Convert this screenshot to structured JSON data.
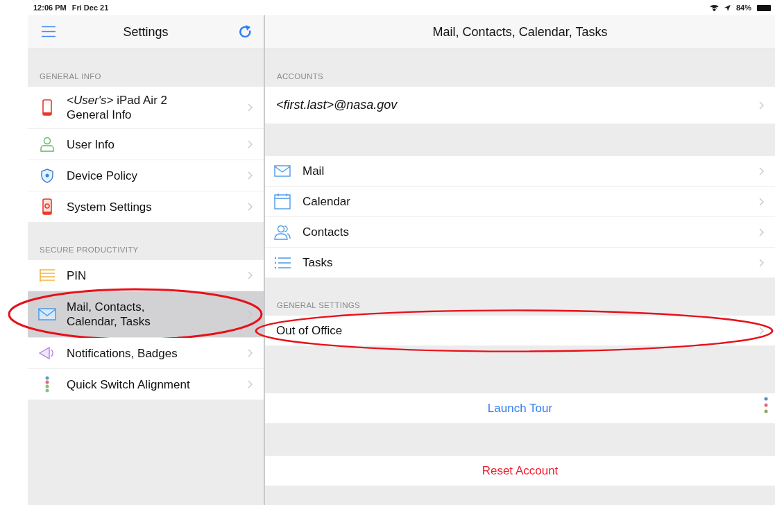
{
  "status_bar": {
    "time": "12:06 PM",
    "date": "Fri Dec 21",
    "battery": "84%"
  },
  "sidebar": {
    "title": "Settings",
    "sections": [
      {
        "header": "GENERAL INFO",
        "items": [
          {
            "kind": "phone",
            "label": "*<User's>* iPad Air 2",
            "sublabel": "General Info",
            "selected": false,
            "circled": false
          },
          {
            "kind": "person",
            "label": "User Info",
            "selected": false,
            "circled": false
          },
          {
            "kind": "shield",
            "label": "Device Policy",
            "selected": false,
            "circled": false
          },
          {
            "kind": "device",
            "label": "System Settings",
            "selected": false,
            "circled": false
          }
        ]
      },
      {
        "header": "SECURE PRODUCTIVITY",
        "items": [
          {
            "kind": "list",
            "label": "PIN",
            "selected": false,
            "circled": false
          },
          {
            "kind": "mail",
            "label": "Mail, Contacts,",
            "sublabel": "Calendar, Tasks",
            "selected": true,
            "circled": true
          },
          {
            "kind": "speaker",
            "label": "Notifications, Badges",
            "selected": false,
            "circled": false
          },
          {
            "kind": "dots",
            "label": "Quick Switch Alignment",
            "selected": false,
            "circled": false
          }
        ]
      }
    ]
  },
  "detail": {
    "title": "Mail, Contacts, Calendar, Tasks",
    "groups": [
      {
        "header": "ACCOUNTS",
        "rows": [
          {
            "kind": "account",
            "label": "<first.last>@nasa.gov",
            "circled": false
          }
        ]
      },
      {
        "rows": [
          {
            "kind": "mail",
            "label": "Mail",
            "circled": false
          },
          {
            "kind": "calendar",
            "label": "Calendar",
            "circled": false
          },
          {
            "kind": "contacts",
            "label": "Contacts",
            "circled": false
          },
          {
            "kind": "tasks",
            "label": "Tasks",
            "circled": false
          }
        ]
      },
      {
        "header": "GENERAL SETTINGS",
        "rows": [
          {
            "kind": "plain",
            "label": "Out of Office",
            "circled": true
          }
        ]
      },
      {
        "rows": [
          {
            "kind": "action",
            "label": "Launch Tour",
            "color": "#2f7cf6"
          }
        ]
      },
      {
        "rows": [
          {
            "kind": "action",
            "label": "Reset Account",
            "color": "#f01a2c"
          }
        ]
      }
    ]
  }
}
